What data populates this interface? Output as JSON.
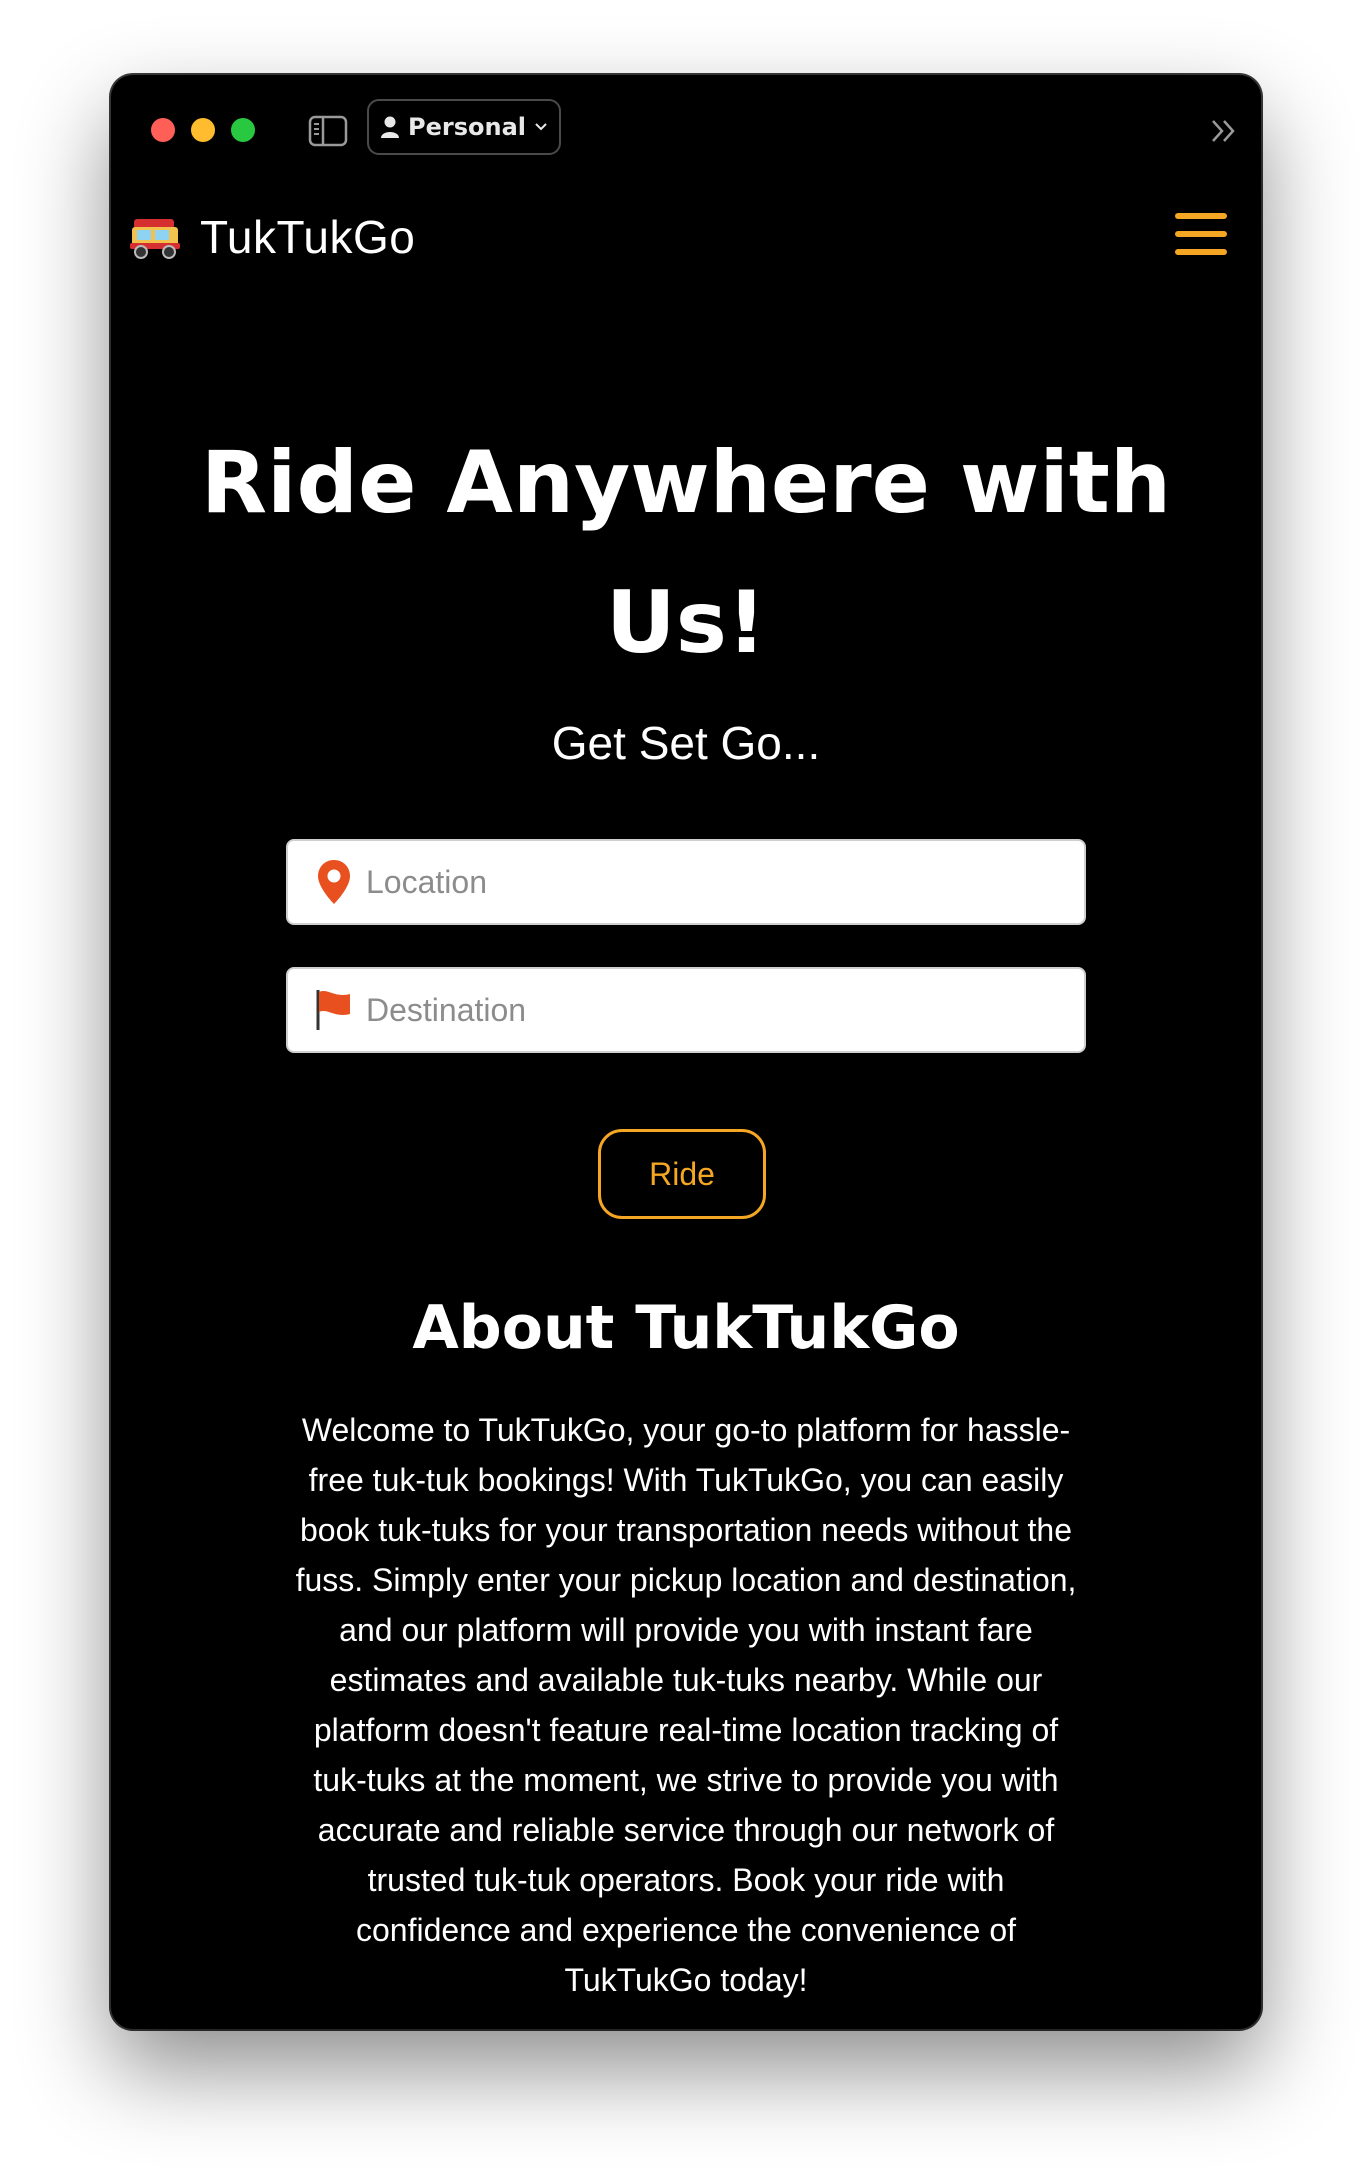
{
  "browser": {
    "profile_label": "Personal"
  },
  "navbar": {
    "brand_name": "TukTukGo",
    "brand_icon": "auto-rickshaw-icon",
    "menu_icon": "hamburger-menu-icon"
  },
  "hero": {
    "title_line1": "Ride Anywhere with",
    "title_line2": "Us!",
    "subtitle": "Get Set Go..."
  },
  "form": {
    "location_placeholder": "Location",
    "location_value": "",
    "destination_placeholder": "Destination",
    "destination_value": "",
    "ride_label": "Ride"
  },
  "about": {
    "title": "About TukTukGo",
    "lines": [
      "Welcome to TukTukGo, your go-to platform for hassle-",
      "free tuk-tuk bookings! With TukTukGo, you can easily",
      "book tuk-tuks for your transportation needs without the",
      "fuss. Simply enter your pickup location and destination,",
      "and our platform will provide you with instant fare",
      "estimates and available tuk-tuks nearby. While our",
      "platform doesn't feature real-time location tracking of",
      "tuk-tuks at the moment, we strive to provide you with",
      "accurate and reliable service through our network of",
      "trusted tuk-tuk operators. Book your ride with",
      "confidence and experience the convenience of",
      "TukTukGo today!"
    ]
  },
  "colors": {
    "accent": "#f5a623",
    "background": "#000000",
    "pin": "#e8501f",
    "flag": "#e8501f"
  }
}
